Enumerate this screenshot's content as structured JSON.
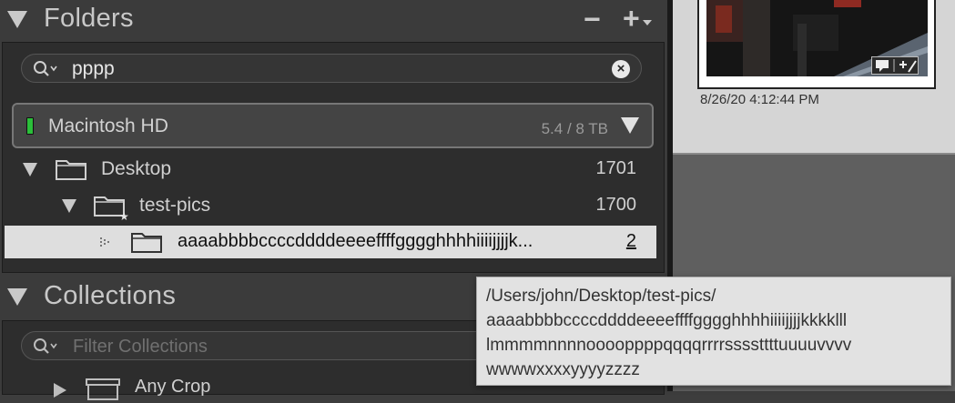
{
  "folders_panel": {
    "title": "Folders",
    "remove_label": "−",
    "add_label": "+",
    "search": {
      "value": "pppp",
      "clear_label": "×"
    },
    "volume": {
      "name": "Macintosh HD",
      "size": "5.4 / 8 TB",
      "status_color": "#2bbf3a"
    },
    "tree": [
      {
        "name": "Desktop",
        "count": "1701"
      },
      {
        "name": "test-pics",
        "count": "1700"
      },
      {
        "name": "aaaabbbbccccddddeeeeffffgggghhhhiiiijjjjk...",
        "count": "2"
      }
    ]
  },
  "collections_panel": {
    "title": "Collections",
    "filter": {
      "placeholder": "Filter Collections"
    },
    "items": [
      {
        "name": "Any Crop"
      }
    ]
  },
  "grid": {
    "cell_date": "8/26/20 4:12:44 PM"
  },
  "tooltip": {
    "lines": [
      "/Users/john/Desktop/test-pics/",
      "aaaabbbbccccddddeeeeffffgggghhhhiiiijjjjkkkklll",
      "lmmmmnnnnooooppppqqqqrrrrssssttttuuuuvvvv",
      "wwwwxxxxyyyyzzzz"
    ]
  },
  "colors": {
    "panel_bg": "#3b3b3b",
    "body_bg": "#2d2d2d",
    "selection_bg": "#dedede",
    "tooltip_bg": "#e2e2e2"
  }
}
